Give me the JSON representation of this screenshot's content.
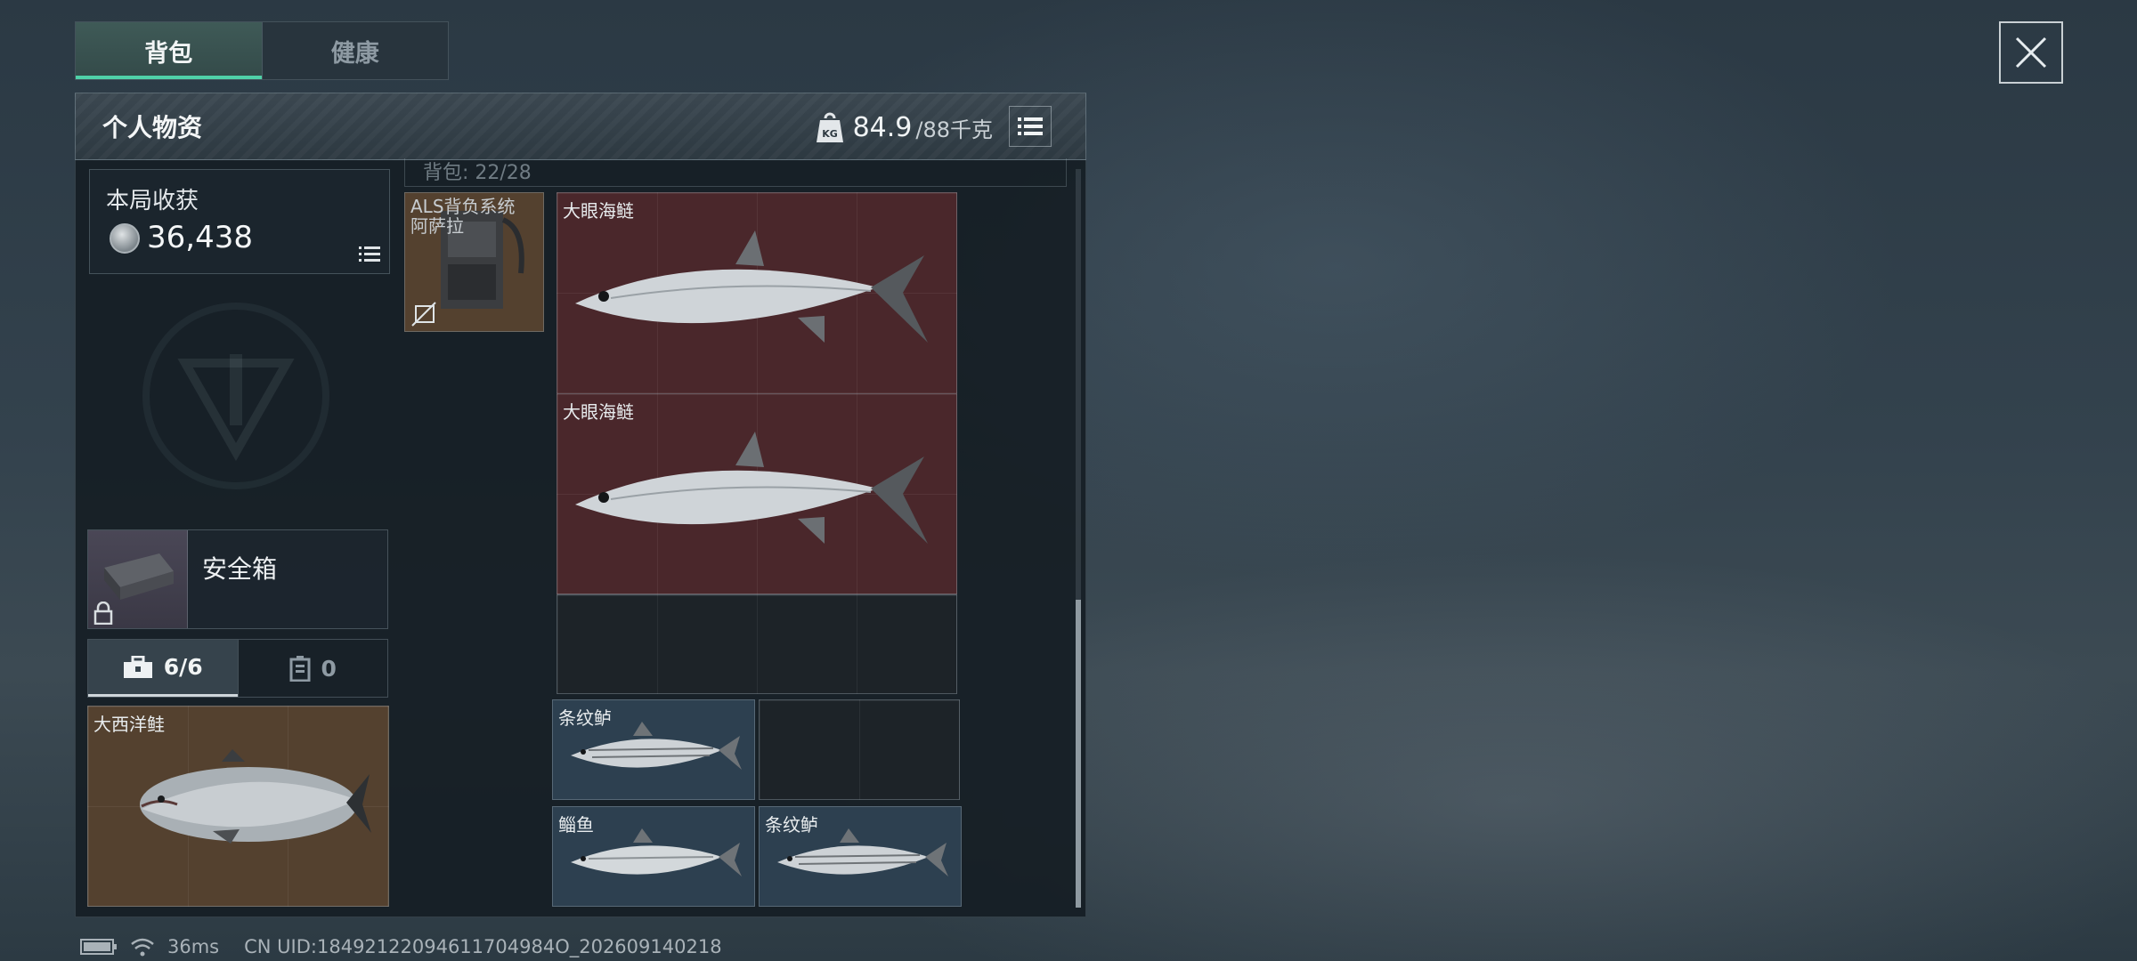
{
  "tabs": [
    {
      "label": "背包",
      "active": true
    },
    {
      "label": "健康",
      "active": false
    }
  ],
  "close_icon": "close-icon",
  "panel": {
    "title": "个人物资",
    "weight_current": "84.9",
    "weight_max": "/88千克",
    "weight_icon": "weight-kg-icon",
    "list_icon": "list-icon"
  },
  "harvest": {
    "label": "本局收获",
    "value": "36,438",
    "coin_icon": "coin-icon"
  },
  "safe_box": {
    "label": "安全箱",
    "lock_icon": "lock-icon"
  },
  "pouch_tabs": [
    {
      "icon": "toolbox-icon",
      "label": "6/6",
      "active": true
    },
    {
      "icon": "battery-case-icon",
      "label": "0",
      "active": false
    }
  ],
  "pouch_item": {
    "name": "大西洋鲑"
  },
  "backpack": {
    "header_text": "背包: 22/28",
    "item": {
      "name": "ALS背负系统\n阿萨拉",
      "no_insure_icon": "no-insurance-icon"
    }
  },
  "items": [
    {
      "name": "大眼海鲢"
    },
    {
      "name": "大眼海鲢"
    },
    {
      "name": "条纹鲈"
    },
    {
      "name": "鲻鱼"
    },
    {
      "name": "条纹鲈"
    }
  ],
  "status": {
    "battery_icon": "battery-icon",
    "wifi_icon": "wifi-icon",
    "ping": "36ms",
    "uid": "CN UID:18492122094611704984O_202609140218"
  },
  "colors": {
    "accent": "#4fd1a8",
    "rare_red": "#4a272b",
    "common_blue": "#2d4050",
    "brown": "#54412f"
  }
}
